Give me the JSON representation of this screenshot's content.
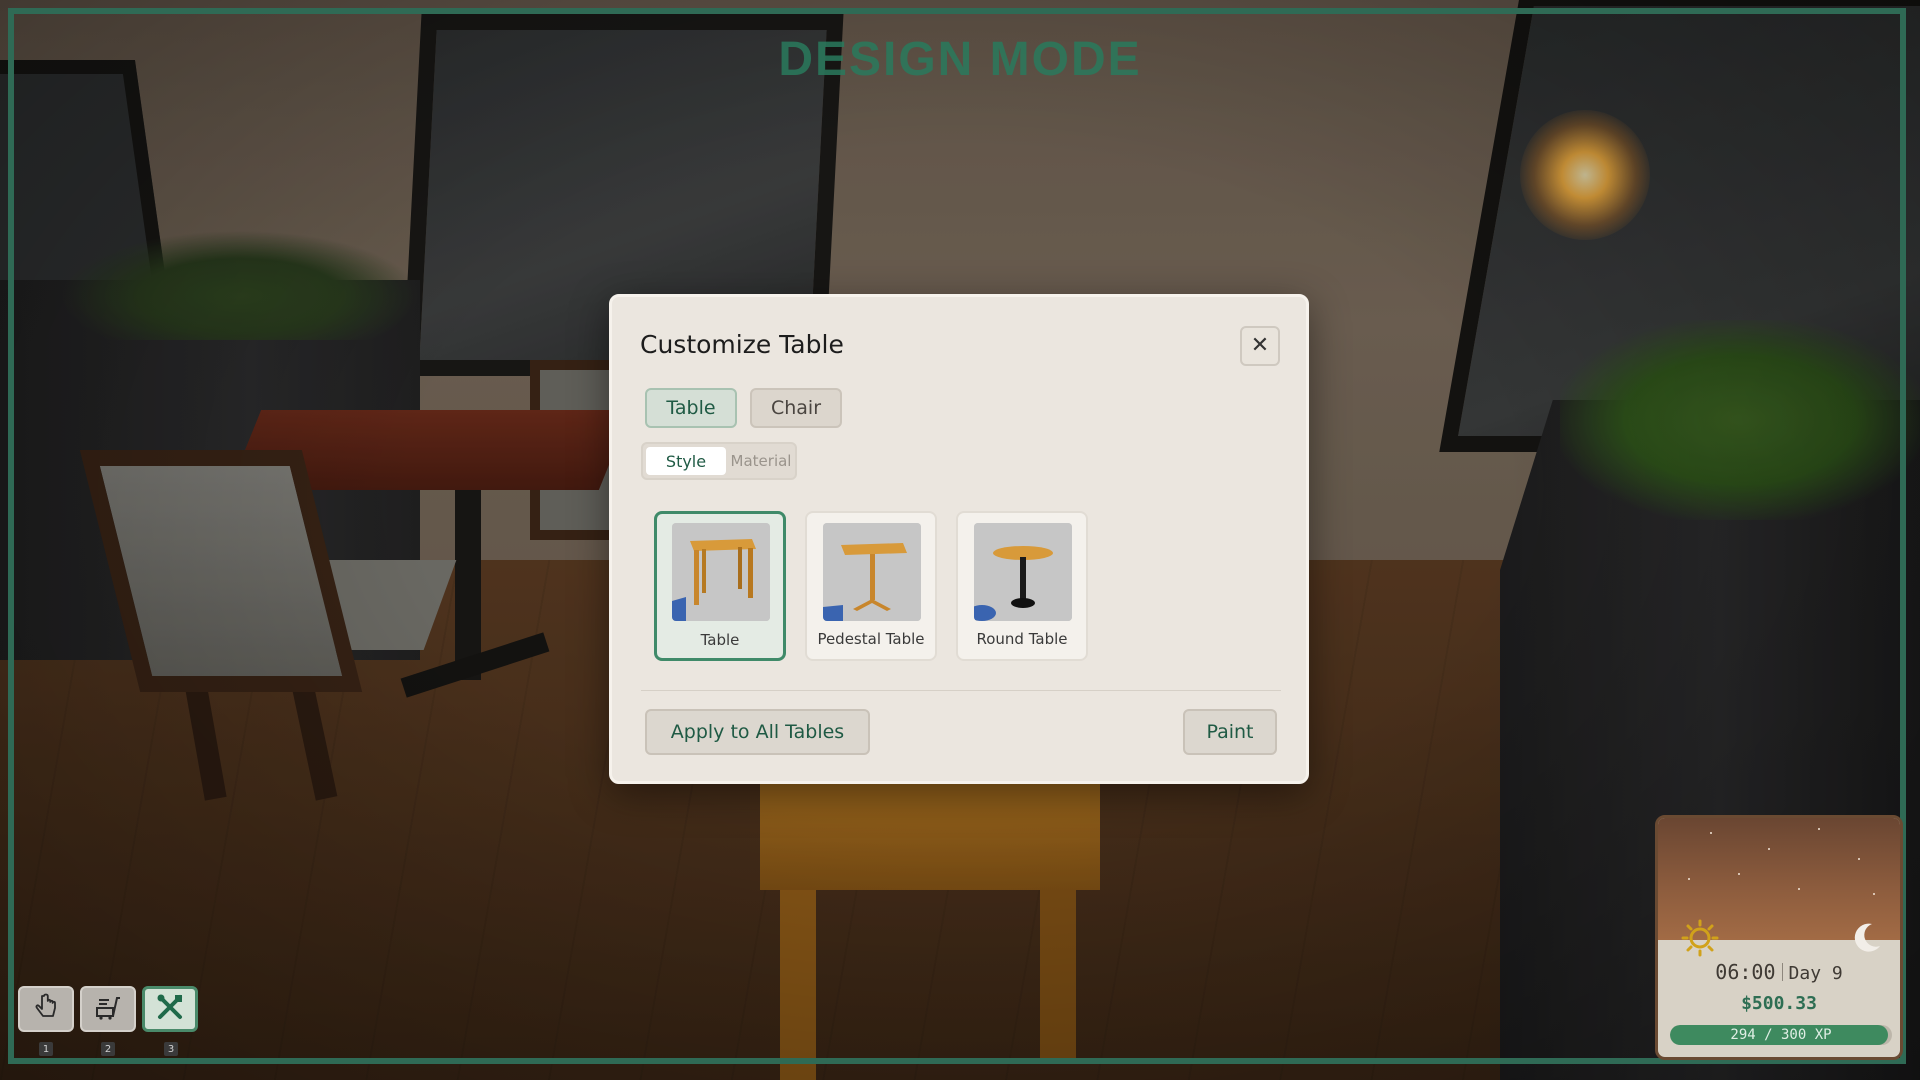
{
  "mode_title": "DESIGN MODE",
  "dialog": {
    "title": "Customize Table",
    "close_icon": "close-icon",
    "tabs": [
      {
        "label": "Table",
        "active": true
      },
      {
        "label": "Chair",
        "active": false
      }
    ],
    "subtabs": [
      {
        "label": "Style",
        "active": true
      },
      {
        "label": "Material",
        "active": false
      }
    ],
    "options": [
      {
        "label": "Table",
        "selected": true
      },
      {
        "label": "Pedestal Table",
        "selected": false
      },
      {
        "label": "Round Table",
        "selected": false
      }
    ],
    "apply_label": "Apply to All Tables",
    "paint_label": "Paint"
  },
  "hotbar": [
    {
      "icon": "hand-pointer-icon",
      "key": "1",
      "active": false
    },
    {
      "icon": "cart-icon",
      "key": "2",
      "active": false
    },
    {
      "icon": "design-tools-icon",
      "key": "3",
      "active": true
    }
  ],
  "hud": {
    "time": "06:00",
    "day": "Day 9",
    "money": "$500.33",
    "xp_text": "294 / 300 XP",
    "xp_current": 294,
    "xp_max": 300
  },
  "colors": {
    "accent": "#2e6e53",
    "frame": "#2f6a55",
    "xp_fill": "#3e8a5f"
  }
}
